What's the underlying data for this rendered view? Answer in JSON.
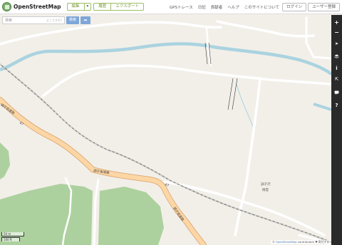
{
  "header": {
    "brand": "OpenStreetMap",
    "edit_label": "編集",
    "history_label": "履歴",
    "export_label": "エクスポート",
    "nav": [
      "GPSトレース",
      "日記",
      "貢献者",
      "ヘルプ",
      "このサイトについて"
    ],
    "login_label": "ログイン",
    "signup_label": "ユーザー登録"
  },
  "search": {
    "placeholder": "検索",
    "where_label": "どこですか?",
    "button_label": "検索"
  },
  "map": {
    "road_labels": [
      "調子坂道路",
      "47",
      "調子坂道路",
      "調子坂道路",
      "47"
    ],
    "place_label": [
      "調子沢",
      "精霊"
    ],
    "colors": {
      "land": "#f2efe9",
      "road_primary": "#fcd6a4",
      "road_minor": "#ffffff",
      "water": "#aad3df",
      "forest": "#add19e",
      "rail": "#777777"
    }
  },
  "controls": {
    "icons": [
      "zoom-in-icon",
      "zoom-out-icon",
      "locate-icon",
      "layers-icon",
      "info-icon",
      "share-icon",
      "note-icon",
      "help-icon"
    ]
  },
  "scale": {
    "metric": "50 m",
    "imperial": "100 ft"
  },
  "attribution": {
    "text": "© ",
    "link": "OpenStreetMap",
    "suffix": " contributors ♥ 寄付する"
  }
}
